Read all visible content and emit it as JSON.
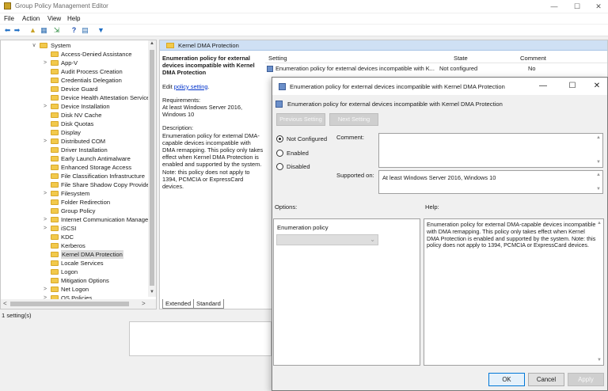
{
  "window": {
    "title": "Group Policy Management Editor",
    "minimize": "—",
    "maximize": "☐",
    "close": "✕"
  },
  "menu": [
    "File",
    "Action",
    "View",
    "Help"
  ],
  "tree": {
    "root": "System",
    "items": [
      {
        "label": "Access-Denied Assistance",
        "expand": ""
      },
      {
        "label": "App-V",
        "expand": ">"
      },
      {
        "label": "Audit Process Creation",
        "expand": ""
      },
      {
        "label": "Credentials Delegation",
        "expand": ""
      },
      {
        "label": "Device Guard",
        "expand": ""
      },
      {
        "label": "Device Health Attestation Service",
        "expand": ""
      },
      {
        "label": "Device Installation",
        "expand": ">"
      },
      {
        "label": "Disk NV Cache",
        "expand": ""
      },
      {
        "label": "Disk Quotas",
        "expand": ""
      },
      {
        "label": "Display",
        "expand": ""
      },
      {
        "label": "Distributed COM",
        "expand": ">"
      },
      {
        "label": "Driver Installation",
        "expand": ""
      },
      {
        "label": "Early Launch Antimalware",
        "expand": ""
      },
      {
        "label": "Enhanced Storage Access",
        "expand": ""
      },
      {
        "label": "File Classification Infrastructure",
        "expand": ""
      },
      {
        "label": "File Share Shadow Copy Provider",
        "expand": ""
      },
      {
        "label": "Filesystem",
        "expand": ">"
      },
      {
        "label": "Folder Redirection",
        "expand": ""
      },
      {
        "label": "Group Policy",
        "expand": ""
      },
      {
        "label": "Internet Communication Manager",
        "expand": ">"
      },
      {
        "label": "iSCSI",
        "expand": ">"
      },
      {
        "label": "KDC",
        "expand": ""
      },
      {
        "label": "Kerberos",
        "expand": ""
      },
      {
        "label": "Kernel DMA Protection",
        "expand": "",
        "selected": true
      },
      {
        "label": "Locale Services",
        "expand": ""
      },
      {
        "label": "Logon",
        "expand": ""
      },
      {
        "label": "Mitigation Options",
        "expand": ""
      },
      {
        "label": "Net Logon",
        "expand": ">"
      },
      {
        "label": "OS Policies",
        "expand": ">"
      }
    ]
  },
  "right_pane": {
    "header": "Kernel DMA Protection",
    "policy_title": "Enumeration policy for external devices incompatible with Kernel DMA Protection",
    "edit_prefix": "Edit ",
    "edit_link": "policy setting",
    "edit_suffix": ".",
    "requirements_label": "Requirements:",
    "requirements_text": "At least Windows Server 2016, Windows 10",
    "description_label": "Description:",
    "description_text": "Enumeration policy for external DMA-capable devices incompatible with DMA remapping. This policy only takes effect when Kernel DMA Protection is enabled and supported by the system. Note: this policy does not apply to 1394, PCMCIA or ExpressCard devices.",
    "columns": {
      "setting": "Setting",
      "state": "State",
      "comment": "Comment"
    },
    "rows": [
      {
        "setting": "Enumeration policy for external devices incompatible with K...",
        "state": "Not configured",
        "comment": "No"
      }
    ],
    "tabs": [
      "Extended",
      "Standard"
    ]
  },
  "status": "1 setting(s)",
  "dialog": {
    "title": "Enumeration policy for external devices incompatible with Kernel DMA Protection",
    "subtitle": "Enumeration policy for external devices incompatible with Kernel DMA Protection",
    "previous_setting": "Previous Setting",
    "next_setting": "Next Setting",
    "minimize": "—",
    "maximize": "☐",
    "close": "✕",
    "radios": [
      {
        "label": "Not Configured",
        "checked": true
      },
      {
        "label": "Enabled",
        "checked": false
      },
      {
        "label": "Disabled",
        "checked": false
      }
    ],
    "comment_label": "Comment:",
    "supported_label": "Supported on:",
    "supported_value": "At least Windows Server 2016, Windows 10",
    "options_label": "Options:",
    "help_label": "Help:",
    "option_name": "Enumeration policy",
    "help_text": "Enumeration policy for external DMA-capable devices incompatible with DMA remapping. This policy only takes effect when Kernel DMA Protection is enabled and supported by the system. Note: this policy does not apply to 1394, PCMCIA or ExpressCard devices.",
    "ok": "OK",
    "cancel": "Cancel",
    "apply": "Apply"
  }
}
